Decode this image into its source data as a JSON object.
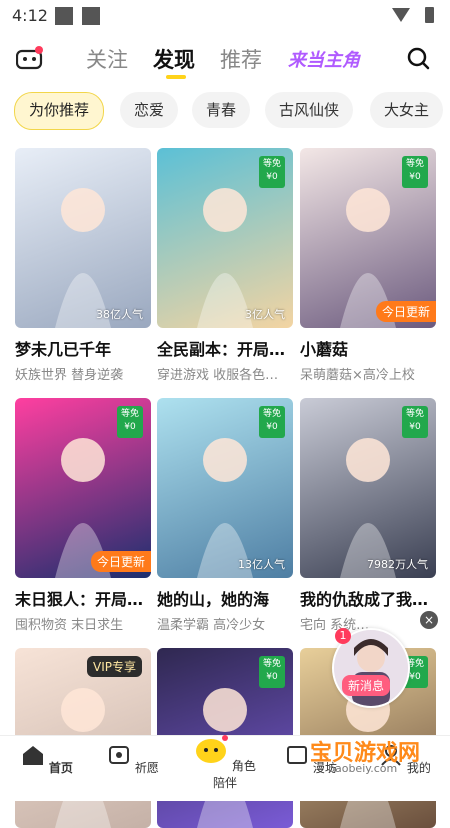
{
  "status": {
    "time": "4:12"
  },
  "topnav": {
    "tabs": [
      "关注",
      "发现",
      "推荐"
    ],
    "active_tab": "发现",
    "promo": "来当主角"
  },
  "chips": [
    "为你推荐",
    "恋爱",
    "青春",
    "古风仙侠",
    "大女主"
  ],
  "cards": [
    {
      "title": "梦未几已千年",
      "tags": "妖族世界 替身逆袭",
      "popularity": "38亿人气",
      "badge": "",
      "updated": "",
      "vip": "",
      "bg1": "#e8eef7",
      "bg2": "#9aa8bf"
    },
    {
      "title": "全民副本：开局…",
      "tags": "穿进游戏 收服各色…",
      "popularity": "3亿人气",
      "badge": "等免 ¥0",
      "updated": "",
      "vip": "",
      "bg1": "#5bc0d6",
      "bg2": "#f3d4a2"
    },
    {
      "title": "小蘑菇",
      "tags": "呆萌蘑菇×高冷上校",
      "popularity": "",
      "badge": "等免 ¥0",
      "updated": "今日更新",
      "vip": "",
      "bg1": "#f3e7e6",
      "bg2": "#6b5a7e"
    },
    {
      "title": "末日狠人：开局…",
      "tags": "囤积物资 末日求生",
      "popularity": "",
      "badge": "等免 ¥0",
      "updated": "今日更新",
      "vip": "",
      "bg1": "#ff3fa0",
      "bg2": "#1b2f6e"
    },
    {
      "title": "她的山，她的海",
      "tags": "温柔学霸 高冷少女",
      "popularity": "13亿人气",
      "badge": "等免 ¥0",
      "updated": "",
      "vip": "",
      "bg1": "#aee1ef",
      "bg2": "#4e7ea3"
    },
    {
      "title": "我的仇敌成了我…",
      "tags": "宅向 系统…",
      "popularity": "7982万人气",
      "badge": "等免 ¥0",
      "updated": "",
      "vip": "",
      "bg1": "#c9cbd6",
      "bg2": "#3a3f52"
    },
    {
      "title": "",
      "tags": "",
      "popularity": "",
      "badge": "",
      "updated": "",
      "vip": "VIP专享",
      "bg1": "#f7e3d7",
      "bg2": "#c5b1a7"
    },
    {
      "title": "",
      "tags": "",
      "popularity": "",
      "badge": "等免 ¥0",
      "updated": "",
      "vip": "",
      "bg1": "#2f2850",
      "bg2": "#7a5bd6"
    },
    {
      "title": "",
      "tags": "",
      "popularity": "",
      "badge": "等免 ¥0",
      "updated": "",
      "vip": "",
      "bg1": "#e8cf9a",
      "bg2": "#6a4f3d"
    }
  ],
  "float": {
    "label": "新消息",
    "count": "1",
    "close": "×"
  },
  "bottom": {
    "items": [
      "首页",
      "祈愿",
      "角色陪伴",
      "漫坊",
      "我的"
    ],
    "active": "首页"
  },
  "watermark": {
    "main": "宝贝游戏网",
    "sub": "baobeiy.com"
  },
  "colors": {
    "accent": "#ffd31a",
    "badge_green": "#22a84c",
    "update_orange": "#ff7a1a",
    "promo_purple": "#b05bff"
  }
}
